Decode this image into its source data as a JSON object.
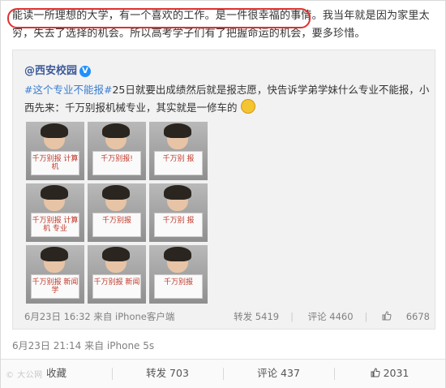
{
  "post": {
    "text_highlighted": "能读一所理想的大学，有一个喜欢的工作。是一件很幸福的事情。",
    "text_rest": "我当年就是因为家里太穷，失去了选择的机会。所以高考学子们有了把握命运的机会，要多珍惜。",
    "time_source": "6月23日 21:14 来自 iPhone 5s"
  },
  "repost": {
    "author": "@西安校园",
    "topic": "#这个专业不能报#",
    "text": "25日就要出成绩然后就是报志愿，快告诉学弟学妹什么专业不能报，小西先来：千万别报机械专业，其实就是一修车的",
    "photos": [
      {
        "sign": "千万别报 计算机"
      },
      {
        "sign": "千万别报!"
      },
      {
        "sign": "千万别 报"
      },
      {
        "sign": "千万别报 计算机 专业"
      },
      {
        "sign": "千万别报"
      },
      {
        "sign": "千万别 报"
      },
      {
        "sign": "千万别报 新闻 学"
      },
      {
        "sign": "千万别报 新闻"
      },
      {
        "sign": "千万别报"
      }
    ],
    "time_source": "6月23日 16:32 来自 iPhone客户端",
    "repost_label": "转发 5419",
    "comment_label": "评论 4460",
    "like_count": "6678"
  },
  "actions": {
    "favorite": "收藏",
    "repost": "转发 703",
    "comment": "评论 437",
    "like": "2031"
  },
  "watermark": "© 大公网"
}
